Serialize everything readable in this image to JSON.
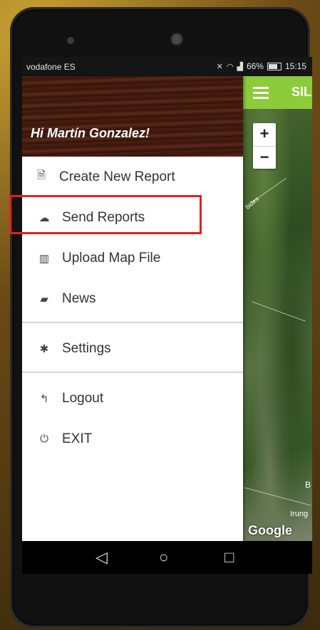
{
  "status": {
    "carrier": "vodafone ES",
    "battery": "66%",
    "time": "15:15"
  },
  "app": {
    "title": "SIL"
  },
  "drawer": {
    "greeting": "Hi Martín Gonzalez!",
    "items": [
      {
        "label": "Create New Report",
        "icon": "file-icon"
      },
      {
        "label": "Send Reports",
        "icon": "cloud-upload-icon"
      },
      {
        "label": "Upload Map File",
        "icon": "map-icon"
      },
      {
        "label": "News",
        "icon": "news-icon"
      },
      {
        "label": "Settings",
        "icon": "gear-icon"
      },
      {
        "label": "Logout",
        "icon": "reply-icon"
      },
      {
        "label": "EXIT",
        "icon": "power-icon"
      }
    ]
  },
  "map": {
    "zoom_in": "+",
    "zoom_out": "−",
    "road_label": "bides",
    "place_label": "Irung",
    "letter_label": "B",
    "attribution": "Google"
  },
  "nav": {
    "back": "◁",
    "home": "○",
    "recents": "□"
  },
  "colors": {
    "appbar": "#8ccc3a",
    "highlight": "#e0211d"
  }
}
